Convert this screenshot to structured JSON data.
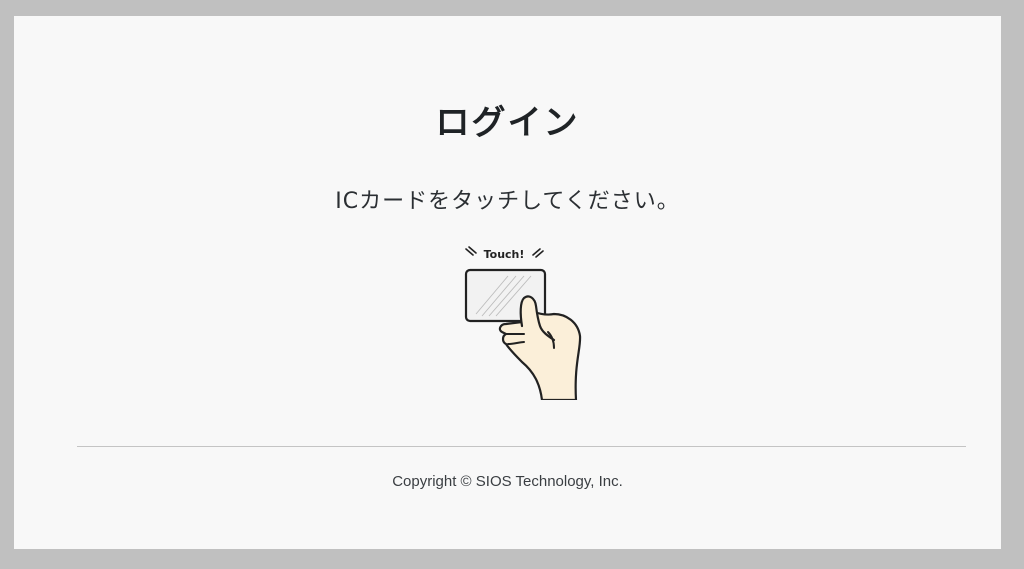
{
  "login": {
    "title": "ログイン",
    "instruction": "ICカードをタッチしてください。",
    "illustration": {
      "caption": "Touch!",
      "icon": "hand-touch-ic-card-icon"
    }
  },
  "footer": {
    "copyright": "Copyright © SIOS Technology, Inc."
  },
  "colors": {
    "window_frame": "#c0c0c0",
    "page_background": "#f8f8f8",
    "text": "#1f2326",
    "skin": "#fbefd9",
    "divider": "#c4c4c4"
  }
}
